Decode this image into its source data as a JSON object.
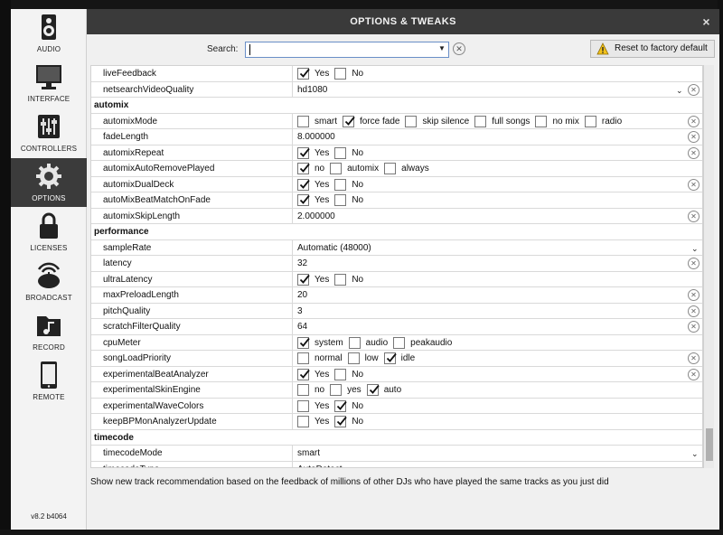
{
  "sidebar": {
    "items": [
      {
        "label": "AUDIO",
        "icon": "speaker-icon"
      },
      {
        "label": "INTERFACE",
        "icon": "monitor-icon"
      },
      {
        "label": "CONTROLLERS",
        "icon": "sliders-icon"
      },
      {
        "label": "OPTIONS",
        "icon": "gear-icon",
        "active": true
      },
      {
        "label": "LICENSES",
        "icon": "lock-icon"
      },
      {
        "label": "BROADCAST",
        "icon": "broadcast-icon"
      },
      {
        "label": "RECORD",
        "icon": "music-folder-icon"
      },
      {
        "label": "REMOTE",
        "icon": "tablet-icon"
      }
    ],
    "version": "v8.2 b4064"
  },
  "dialog": {
    "title": "OPTIONS & TWEAKS",
    "close": "×",
    "search_label": "Search:",
    "search_value": "",
    "reset_label": "Reset to factory default"
  },
  "rows": [
    {
      "name": "liveFeedback",
      "options": [
        {
          "label": "Yes",
          "checked": true
        },
        {
          "label": "No",
          "checked": false
        }
      ]
    },
    {
      "name": "netsearchVideoQuality",
      "value": "hd1080",
      "dropdown": true,
      "reset": true
    },
    {
      "section": "automix"
    },
    {
      "name": "automixMode",
      "options": [
        {
          "label": "smart",
          "checked": false
        },
        {
          "label": "force fade",
          "checked": true
        },
        {
          "label": "skip silence",
          "checked": false
        },
        {
          "label": "full songs",
          "checked": false
        },
        {
          "label": "no mix",
          "checked": false
        },
        {
          "label": "radio",
          "checked": false
        }
      ],
      "reset": true
    },
    {
      "name": "fadeLength",
      "value": "8.000000",
      "reset": true
    },
    {
      "name": "automixRepeat",
      "options": [
        {
          "label": "Yes",
          "checked": true
        },
        {
          "label": "No",
          "checked": false
        }
      ],
      "reset": true
    },
    {
      "name": "automixAutoRemovePlayed",
      "options": [
        {
          "label": "no",
          "checked": true
        },
        {
          "label": "automix",
          "checked": false
        },
        {
          "label": "always",
          "checked": false
        }
      ]
    },
    {
      "name": "automixDualDeck",
      "options": [
        {
          "label": "Yes",
          "checked": true
        },
        {
          "label": "No",
          "checked": false
        }
      ],
      "reset": true
    },
    {
      "name": "autoMixBeatMatchOnFade",
      "options": [
        {
          "label": "Yes",
          "checked": true
        },
        {
          "label": "No",
          "checked": false
        }
      ]
    },
    {
      "name": "automixSkipLength",
      "value": "2.000000",
      "reset": true
    },
    {
      "section": "performance"
    },
    {
      "name": "sampleRate",
      "value": "Automatic (48000)",
      "dropdown2": true
    },
    {
      "name": "latency",
      "value": "32",
      "reset": true
    },
    {
      "name": "ultraLatency",
      "options": [
        {
          "label": "Yes",
          "checked": true
        },
        {
          "label": "No",
          "checked": false
        }
      ]
    },
    {
      "name": "maxPreloadLength",
      "value": "20",
      "reset": true
    },
    {
      "name": "pitchQuality",
      "value": "3",
      "reset": true
    },
    {
      "name": "scratchFilterQuality",
      "value": "64",
      "reset": true
    },
    {
      "name": "cpuMeter",
      "options": [
        {
          "label": "system",
          "checked": true
        },
        {
          "label": "audio",
          "checked": false
        },
        {
          "label": "peakaudio",
          "checked": false
        }
      ]
    },
    {
      "name": "songLoadPriority",
      "options": [
        {
          "label": "normal",
          "checked": false
        },
        {
          "label": "low",
          "checked": false
        },
        {
          "label": "idle",
          "checked": true
        }
      ],
      "reset": true
    },
    {
      "name": "experimentalBeatAnalyzer",
      "options": [
        {
          "label": "Yes",
          "checked": true
        },
        {
          "label": "No",
          "checked": false
        }
      ],
      "reset": true
    },
    {
      "name": "experimentalSkinEngine",
      "options": [
        {
          "label": "no",
          "checked": false
        },
        {
          "label": "yes",
          "checked": false
        },
        {
          "label": "auto",
          "checked": true
        }
      ]
    },
    {
      "name": "experimentalWaveColors",
      "options": [
        {
          "label": "Yes",
          "checked": false
        },
        {
          "label": "No",
          "checked": true
        }
      ]
    },
    {
      "name": "keepBPMonAnalyzerUpdate",
      "options": [
        {
          "label": "Yes",
          "checked": false
        },
        {
          "label": "No",
          "checked": true
        }
      ]
    },
    {
      "section": "timecode"
    },
    {
      "name": "timecodeMode",
      "value": "smart",
      "dropdown2": true
    },
    {
      "name": "timecodeType",
      "value": "AutoDetect",
      "dropdown2": true
    }
  ],
  "footer_text": "Show new track recommendation based on the feedback of millions of other DJs who have played the same tracks as you just did",
  "colors": {
    "sidebar_active": "#3b3b3b",
    "titlebar": "#3a3a3a",
    "search_border": "#6a8fc7"
  }
}
